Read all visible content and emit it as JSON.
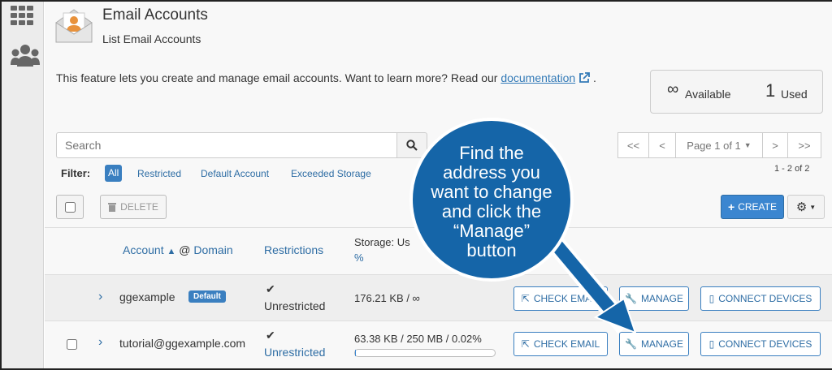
{
  "header": {
    "title": "Email Accounts",
    "subtitle": "List Email Accounts"
  },
  "description": {
    "text": "This feature lets you create and manage email accounts. Want to learn more? Read our",
    "link": "documentation",
    "suffix": "."
  },
  "stats": {
    "available_value": "∞",
    "available_label": "Available",
    "used_value": "1",
    "used_label": "Used"
  },
  "search": {
    "placeholder": "Search"
  },
  "pagination": {
    "first": "<<",
    "prev": "<",
    "page": "Page 1 of 1",
    "next": ">",
    "last": ">>",
    "range": "1 - 2 of 2"
  },
  "filter": {
    "label": "Filter:",
    "options": [
      "All",
      "Restricted",
      "Default Account",
      "Exceeded Storage"
    ],
    "selected": "All"
  },
  "toolbar": {
    "delete_label": "DELETE",
    "create_label": "CREATE"
  },
  "table": {
    "col_account": "Account",
    "col_domain": "Domain",
    "col_at": "@",
    "col_restrictions": "Restrictions",
    "col_storage_a": "Storage: Us",
    "col_storage_b": "%",
    "rows": [
      {
        "account": "ggexample",
        "badge": "Default",
        "restriction": "Unrestricted",
        "storage": "176.21 KB / ∞",
        "check_email": "CHECK EMAIL",
        "manage": "MANAGE",
        "connect": "CONNECT DEVICES"
      },
      {
        "account": "tutorial@ggexample.com",
        "restriction": "Unrestricted",
        "storage": "63.38 KB / 250 MB / 0.02%",
        "storage_used_pct": 0.02,
        "check_email": "CHECK EMAIL",
        "manage": "MANAGE",
        "connect": "CONNECT DEVICES"
      }
    ]
  },
  "callout": {
    "lines": [
      "Find the",
      "address you",
      "want to change",
      "and click the",
      "“Manage”",
      "button"
    ],
    "color": "#1565a8"
  },
  "colors": {
    "primary": "#3b86d0",
    "link": "#2e6da4",
    "badge": "#3a7fc0"
  }
}
